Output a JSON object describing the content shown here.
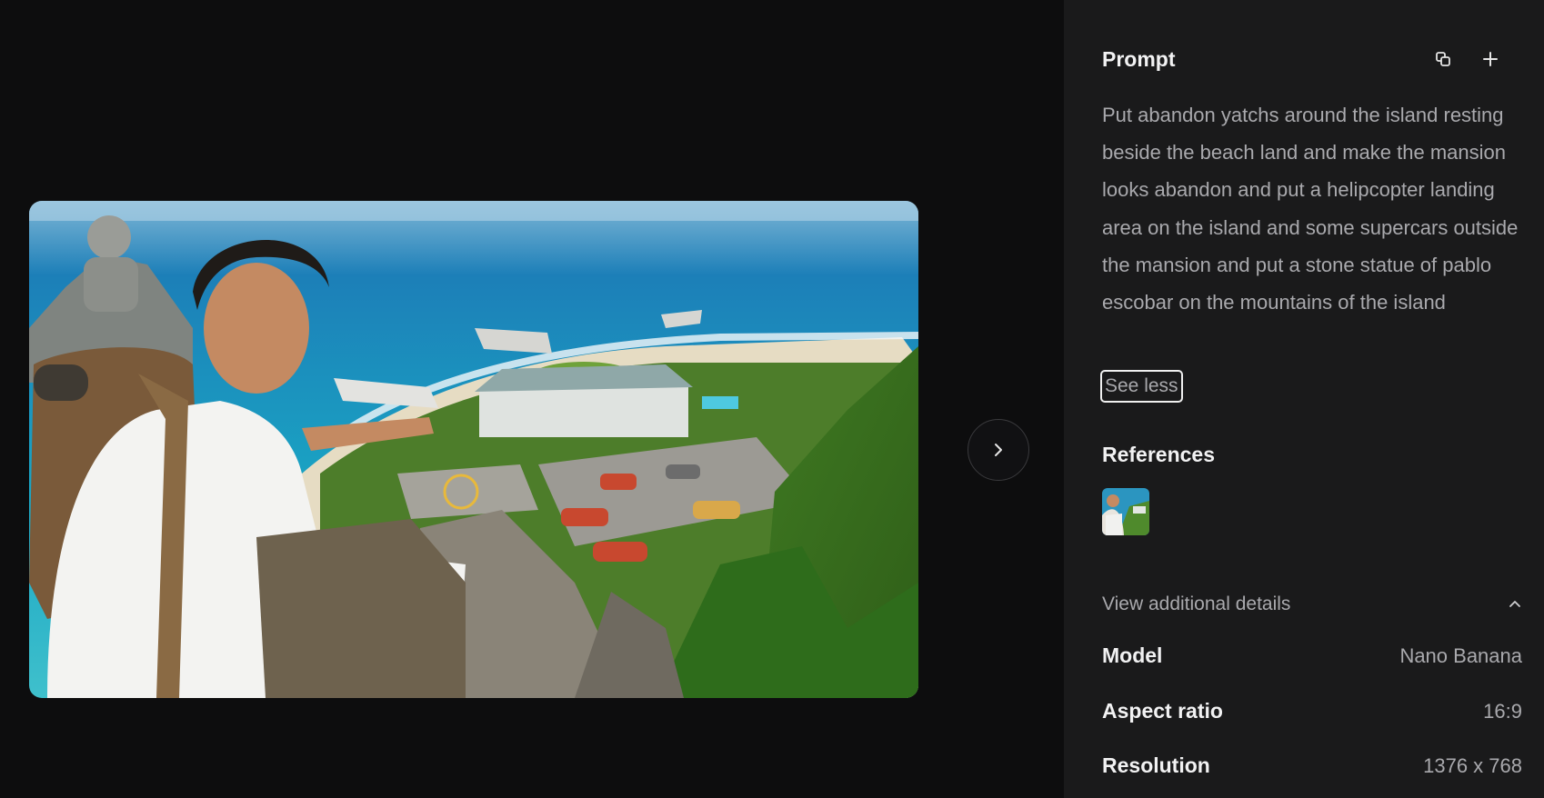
{
  "panel": {
    "prompt_title": "Prompt",
    "prompt_text": "Put abandon yatchs around the island resting beside the beach land and make the mansion looks abandon and put a helipcopter landing area on the island and some supercars outside the mansion and put a stone statue of pablo escobar on the mountains of the island",
    "see_less_label": "See less",
    "references_title": "References",
    "additional_details_label": "View additional details",
    "details": [
      {
        "key": "Model",
        "value": "Nano Banana"
      },
      {
        "key": "Aspect ratio",
        "value": "16:9"
      },
      {
        "key": "Resolution",
        "value": "1376 x 768"
      }
    ]
  },
  "icons": {
    "copy": "copy-icon",
    "add": "plus-icon",
    "next": "chevron-right-icon",
    "collapse": "chevron-up-icon"
  },
  "colors": {
    "background": "#0d0d0e",
    "panel": "#1a1a1b",
    "text_primary": "#f2f2f3",
    "text_secondary": "#a9a9ad"
  }
}
